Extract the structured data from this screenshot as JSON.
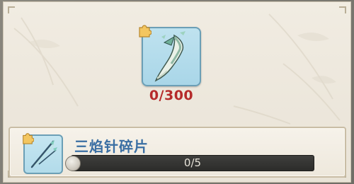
{
  "main_item": {
    "icon": "blade-icon",
    "count": "0/300",
    "count_color": "#b52b2b",
    "badge_icon": "puzzle-piece-icon"
  },
  "fragment": {
    "name": "三焰针碎片",
    "icon": "needle-icon",
    "badge_icon": "puzzle-piece-icon",
    "progress_text": "0/5",
    "progress_current": 0,
    "progress_total": 5,
    "name_color": "#3b6fa3"
  }
}
